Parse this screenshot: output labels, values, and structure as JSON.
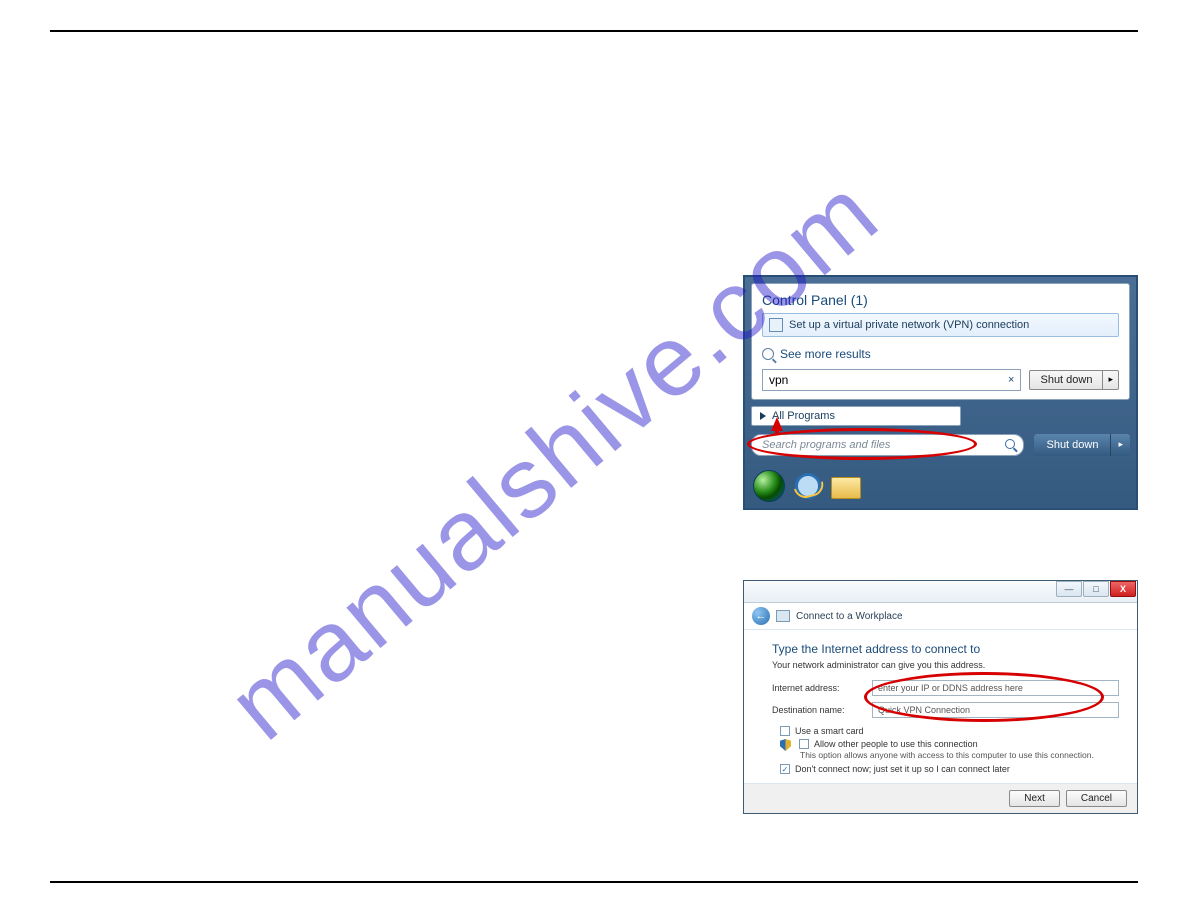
{
  "watermark": "manualshive.com",
  "shot1": {
    "cp_heading": "Control Panel (1)",
    "cp_item": "Set up a virtual private network (VPN) connection",
    "see_more": "See more results",
    "search_value": "vpn",
    "clear": "×",
    "shutdown": "Shut down",
    "arrow": "▸",
    "all_programs": "All Programs",
    "search_placeholder": "Search programs and files",
    "shutdown2": "Shut down"
  },
  "shot2": {
    "header_title": "Connect to a Workplace",
    "wiz_title": "Type the Internet address to connect to",
    "wiz_sub": "Your network administrator can give you this address.",
    "label_internet": "Internet address:",
    "field_internet": "enter your IP or DDNS address here",
    "label_dest": "Destination name:",
    "field_dest": "Quick VPN Connection",
    "chk_smart": "Use a smart card",
    "chk_allow": "Allow other people to use this connection",
    "chk_allow_sub": "This option allows anyone with access to this computer to use this connection.",
    "chk_dont": "Don't connect now; just set it up so I can connect later",
    "chk_dont_mark": "✓",
    "btn_next": "Next",
    "btn_cancel": "Cancel",
    "back_arrow": "←",
    "min": "—",
    "max": "□",
    "close": "X"
  }
}
